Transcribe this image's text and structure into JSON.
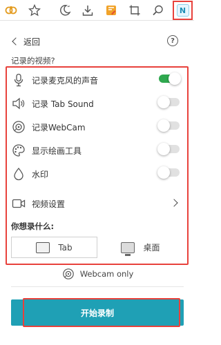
{
  "toolbar": {
    "icons": [
      "extension-icon",
      "star-icon",
      "moon-icon",
      "download-icon",
      "edit-icon",
      "crop-icon",
      "zoom-icon",
      "nimbus-icon"
    ],
    "extension_badge": "N"
  },
  "header": {
    "back_label": "返回",
    "help_label": "?"
  },
  "section_question": "记录的视频?",
  "options": [
    {
      "label": "记录麦克风的声音",
      "icon": "microphone-icon",
      "enabled": true
    },
    {
      "label": "记录 Tab Sound",
      "icon": "speaker-icon",
      "enabled": false
    },
    {
      "label": "记录WebCam",
      "icon": "webcam-icon",
      "enabled": false
    },
    {
      "label": "显示绘画工具",
      "icon": "palette-icon",
      "enabled": false
    },
    {
      "label": "水印",
      "icon": "watermark-icon",
      "enabled": false
    }
  ],
  "video_settings_label": "视频设置",
  "record_question": "你想录什么:",
  "modes": [
    {
      "label": "Tab",
      "selected": true
    },
    {
      "label": "桌面",
      "selected": false
    }
  ],
  "webcam_only_label": "Webcam only",
  "start_button_label": "开始录制",
  "colors": {
    "accent": "#1fa0b5",
    "toggle_on": "#2fa84f",
    "highlight": "#e8413b"
  }
}
